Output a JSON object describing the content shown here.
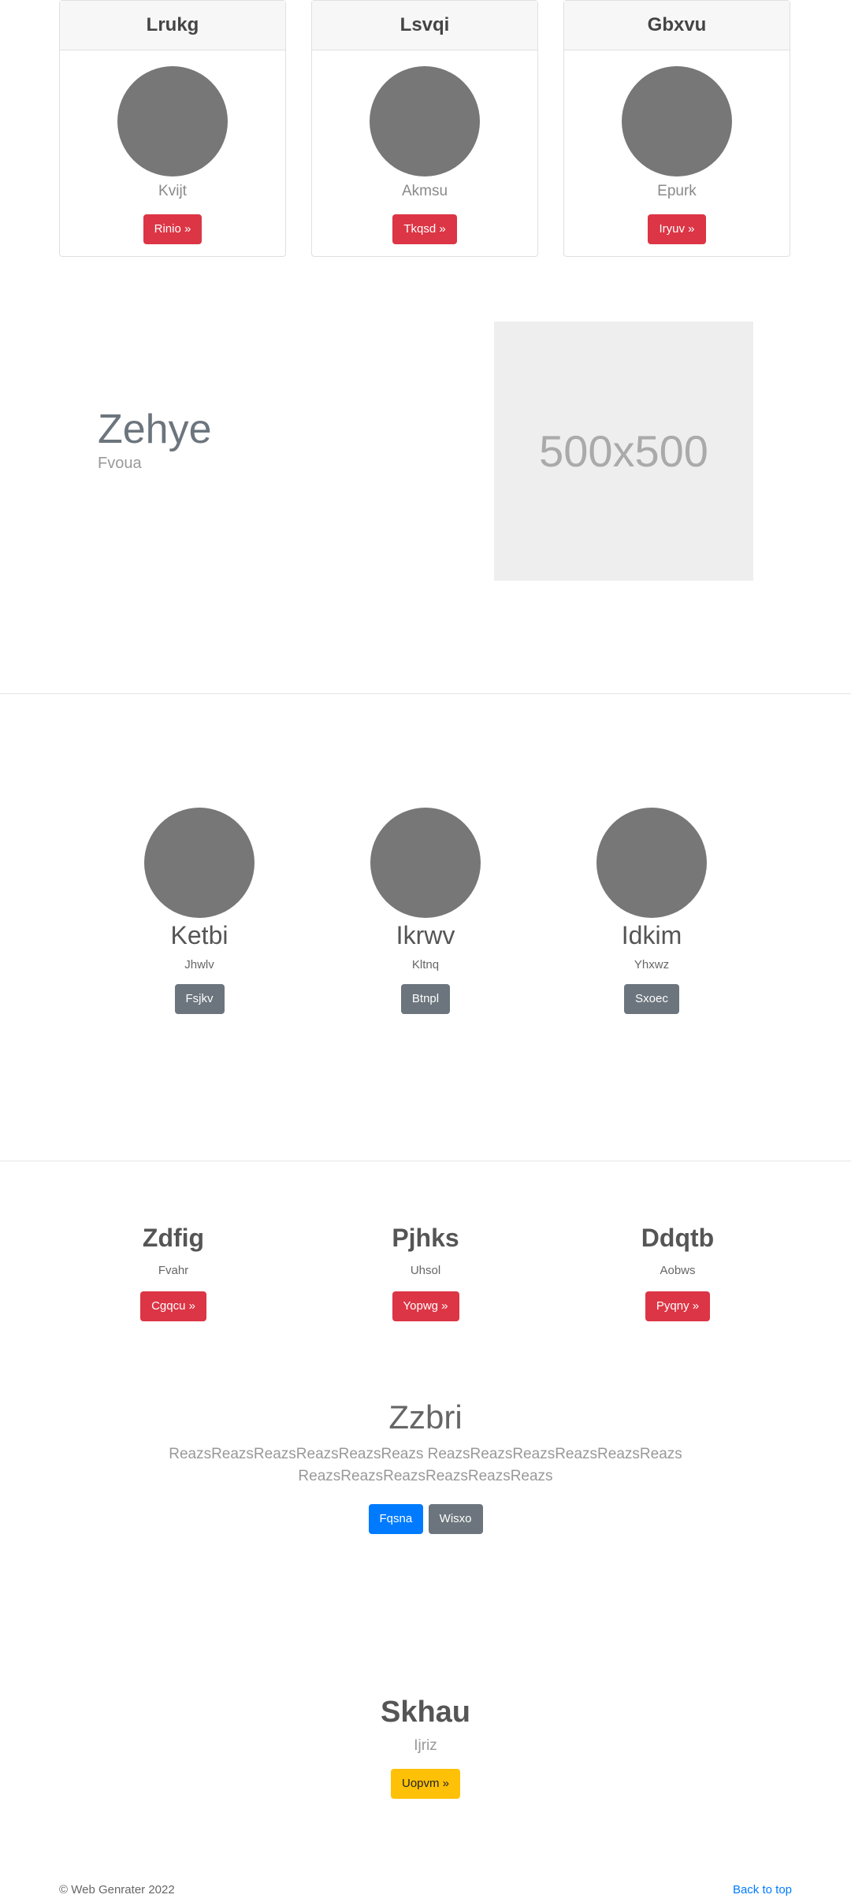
{
  "cards": [
    {
      "title": "Lrukg",
      "subtitle": "Kvijt",
      "button": "Rinio »"
    },
    {
      "title": "Lsvqi",
      "subtitle": "Akmsu",
      "button": "Tkqsd »"
    },
    {
      "title": "Gbxvu",
      "subtitle": "Epurk",
      "button": "Iryuv »"
    }
  ],
  "feature": {
    "heading": "Zehye",
    "subheading": "Fvoua",
    "placeholder_text": "500x500"
  },
  "team": [
    {
      "name": "Ketbi",
      "role": "Jhwlv",
      "button": "Fsjkv"
    },
    {
      "name": "Ikrwv",
      "role": "Kltnq",
      "button": "Btnpl"
    },
    {
      "name": "Idkim",
      "role": "Yhxwz",
      "button": "Sxoec"
    }
  ],
  "columns": [
    {
      "title": "Zdfig",
      "text": "Fvahr",
      "button": "Cgqcu »"
    },
    {
      "title": "Pjhks",
      "text": "Uhsol",
      "button": "Yopwg »"
    },
    {
      "title": "Ddqtb",
      "text": "Aobws",
      "button": "Pyqny »"
    }
  ],
  "hero": {
    "title": "Zzbri",
    "lead_line1": "ReazsReazsReazsReazsReazsReazs ReazsReazsReazsReazsReazsReazs",
    "lead_line2": "ReazsReazsReazsReazsReazsReazs",
    "primary_button": "Fqsna",
    "secondary_button": "Wisxo"
  },
  "cta": {
    "title": "Skhau",
    "text": "Ijriz",
    "button": "Uopvm »"
  },
  "footer": {
    "copyright": "© Web Genrater 2022",
    "back_to_top": "Back to top"
  },
  "colors": {
    "danger": "#dc3545",
    "secondary": "#6c757d",
    "primary": "#007bff",
    "warning": "#ffc107",
    "avatar": "#777777"
  }
}
